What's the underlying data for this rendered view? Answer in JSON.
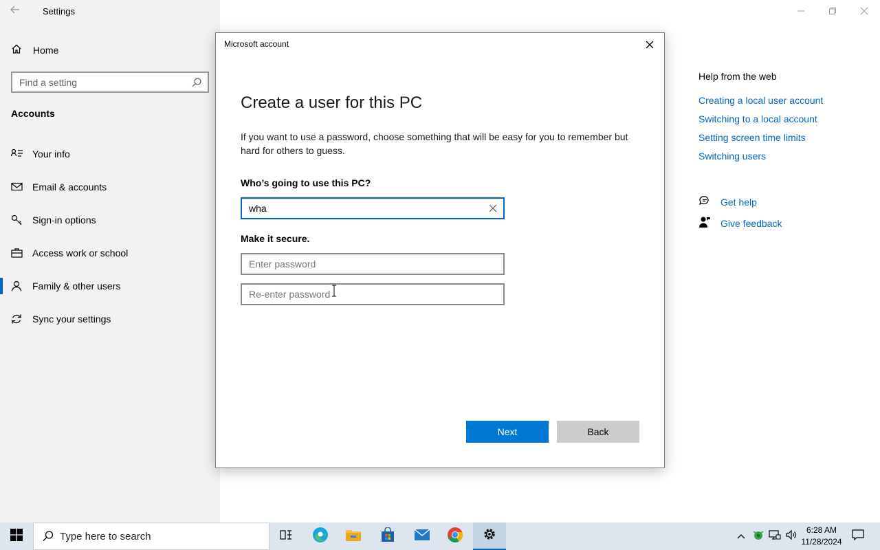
{
  "window": {
    "app_title": "Settings"
  },
  "sidebar": {
    "home_label": "Home",
    "search_placeholder": "Find a setting",
    "section_title": "Accounts",
    "items": [
      {
        "label": "Your info",
        "icon": "your-info-icon"
      },
      {
        "label": "Email & accounts",
        "icon": "email-icon"
      },
      {
        "label": "Sign-in options",
        "icon": "key-icon"
      },
      {
        "label": "Access work or school",
        "icon": "briefcase-icon"
      },
      {
        "label": "Family & other users",
        "icon": "person-icon",
        "active": true
      },
      {
        "label": "Sync your settings",
        "icon": "sync-icon"
      }
    ]
  },
  "help": {
    "title": "Help from the web",
    "links": [
      "Creating a local user account",
      "Switching to a local account",
      "Setting screen time limits",
      "Switching users"
    ],
    "get_help": "Get help",
    "give_feedback": "Give feedback"
  },
  "dialog": {
    "title": "Microsoft account",
    "heading": "Create a user for this PC",
    "description": "If you want to use a password, choose something that will be easy for you to remember but hard for others to guess.",
    "question": "Who’s going to use this PC?",
    "username_value": "wha",
    "secure_label": "Make it secure.",
    "password_placeholder": "Enter password",
    "reenter_placeholder": "Re-enter password",
    "next_label": "Next",
    "back_label": "Back"
  },
  "taskbar": {
    "search_placeholder": "Type here to search",
    "time": "6:28 AM",
    "date": "11/28/2024",
    "apps": [
      "task-view-icon",
      "edge-icon",
      "file-explorer-icon",
      "store-icon",
      "mail-icon",
      "chrome-icon",
      "settings-icon"
    ]
  },
  "colors": {
    "accent": "#0067c0",
    "button_primary": "#0078d4",
    "sidebar_bg": "#f2f2f2",
    "taskbar_bg": "#dde6ee"
  }
}
